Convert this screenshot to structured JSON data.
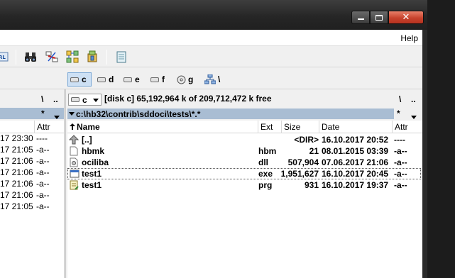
{
  "menu": {
    "help": "Help"
  },
  "toolbar": {
    "icons": [
      "url-icon",
      "binoculars-icon",
      "compare-icon",
      "sync-icon",
      "pack-icon",
      "notepad-icon"
    ]
  },
  "drives": [
    {
      "letter": "c",
      "selected": true
    },
    {
      "letter": "d",
      "selected": false
    },
    {
      "letter": "e",
      "selected": false
    },
    {
      "letter": "f",
      "selected": false
    },
    {
      "letter": "g",
      "selected": false
    },
    {
      "letter": "\\",
      "selected": false
    }
  ],
  "left_pane": {
    "root_label": "\\",
    "parent_label": "..",
    "filter_label": "*",
    "attr_header": "Attr",
    "rows": [
      {
        "date": "17 23:30",
        "attr": "----"
      },
      {
        "date": "17 21:05",
        "attr": "-a--"
      },
      {
        "date": "17 21:06",
        "attr": "-a--"
      },
      {
        "date": "17 21:06",
        "attr": "-a--"
      },
      {
        "date": "17 21:06",
        "attr": "-a--"
      },
      {
        "date": "17 21:06",
        "attr": "-a--"
      },
      {
        "date": "17 21:05",
        "attr": "-a--"
      }
    ]
  },
  "right_pane": {
    "drive_combo": "c",
    "drive_info": "[disk c]  65,192,964 k of  209,712,472 k free",
    "root_label": "\\",
    "parent_label": "..",
    "path": "c:\\hb32\\contrib\\sddoci\\tests\\*.*",
    "filter_label": "*",
    "columns": {
      "name": "Name",
      "ext": "Ext",
      "size": "Size",
      "date": "Date",
      "attr": "Attr"
    },
    "files": [
      {
        "icon": "up-arrow-icon",
        "name": "[..]",
        "ext": "",
        "size": "<DIR>",
        "date": "16.10.2017 20:52",
        "attr": "----"
      },
      {
        "icon": "file-icon",
        "name": "hbmk",
        "ext": "hbm",
        "size": "21",
        "date": "08.01.2015 03:39",
        "attr": "-a--"
      },
      {
        "icon": "dll-gear-icon",
        "name": "ociliba",
        "ext": "dll",
        "size": "507,904",
        "date": "07.06.2017 21:06",
        "attr": "-a--"
      },
      {
        "icon": "exe-window-icon",
        "name": "test1",
        "ext": "exe",
        "size": "1,951,627",
        "date": "16.10.2017 20:45",
        "attr": "-a--"
      },
      {
        "icon": "prg-notepad-icon",
        "name": "test1",
        "ext": "prg",
        "size": "931",
        "date": "16.10.2017 19:37",
        "attr": "-a--"
      }
    ]
  }
}
